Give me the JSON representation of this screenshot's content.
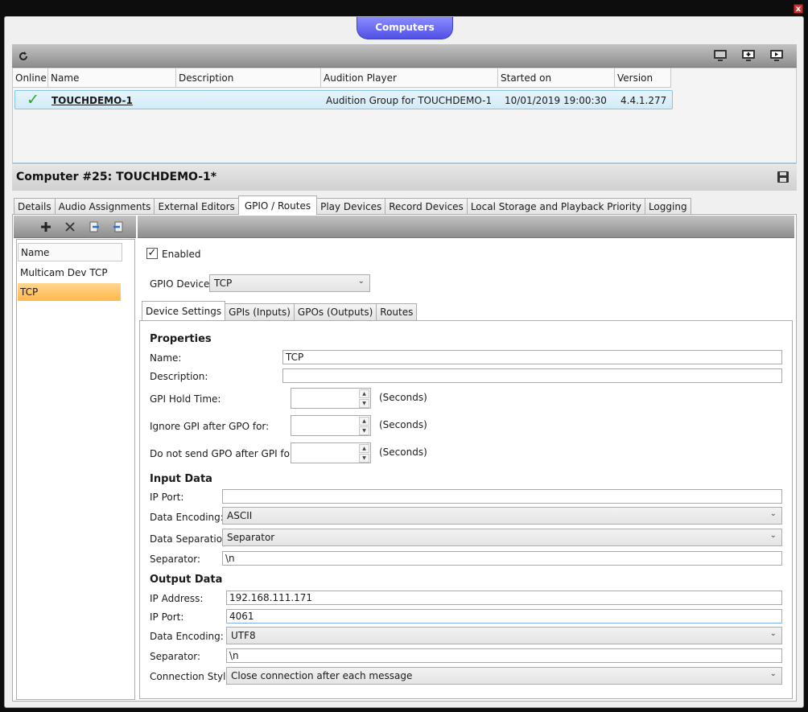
{
  "window": {
    "title": "Computers",
    "close_glyph": "x"
  },
  "toolbar": {
    "icons": [
      "refresh-icon",
      "monitor-icon",
      "add-monitor-icon",
      "play-monitor-icon"
    ]
  },
  "grid": {
    "columns": [
      "Online",
      "Name",
      "Description",
      "Audition Player",
      "Started on",
      "Version"
    ],
    "rows": [
      {
        "online": "✓",
        "name": "TOUCHDEMO-1",
        "description": "",
        "audition_player": "Audition Group for TOUCHDEMO-1",
        "started_on": "10/01/2019 19:00:30",
        "version": "4.4.1.277"
      }
    ]
  },
  "computer": {
    "title": "Computer #25: TOUCHDEMO-1*"
  },
  "tabs": [
    "Details",
    "Audio Assignments",
    "External Editors",
    "GPIO / Routes",
    "Play Devices",
    "Record Devices",
    "Local Storage and Playback Priority",
    "Logging"
  ],
  "left_list": {
    "header": "Name",
    "items": [
      "Multicam Dev TCP",
      "TCP"
    ]
  },
  "gpio": {
    "enabled_label": "Enabled",
    "enabled_check": "✓",
    "device_label": "GPIO Device:",
    "device_value": "TCP",
    "subtabs": [
      "Device Settings",
      "GPIs (Inputs)",
      "GPOs (Outputs)",
      "Routes"
    ],
    "properties": {
      "heading": "Properties",
      "name_label": "Name:",
      "name_value": "TCP",
      "description_label": "Description:",
      "description_value": "",
      "hold_label": "GPI Hold Time:",
      "ignore_label": "Ignore GPI after GPO for:",
      "nosend_label": "Do not send GPO after GPI for:",
      "seconds": "(Seconds)"
    },
    "input": {
      "heading": "Input Data",
      "port_label": "IP Port:",
      "port_value": "",
      "encoding_label": "Data Encoding:",
      "encoding_value": "ASCII",
      "separation_label": "Data Separation:",
      "separation_value": "Separator",
      "separator_label": "Separator:",
      "separator_value": "\\n"
    },
    "output": {
      "heading": "Output Data",
      "address_label": "IP Address:",
      "address_value": "192.168.111.171",
      "port_label": "IP Port:",
      "port_value": "4061",
      "encoding_label": "Data Encoding:",
      "encoding_value": "UTF8",
      "separator_label": "Separator:",
      "separator_value": "\\n",
      "style_label": "Connection Style:",
      "style_value": "Close connection after each message"
    }
  },
  "colors": {
    "accent": "#5050e6",
    "selection": "#ffb84a",
    "row_highlight": "#d2ebf8",
    "check": "#2aa62a"
  }
}
